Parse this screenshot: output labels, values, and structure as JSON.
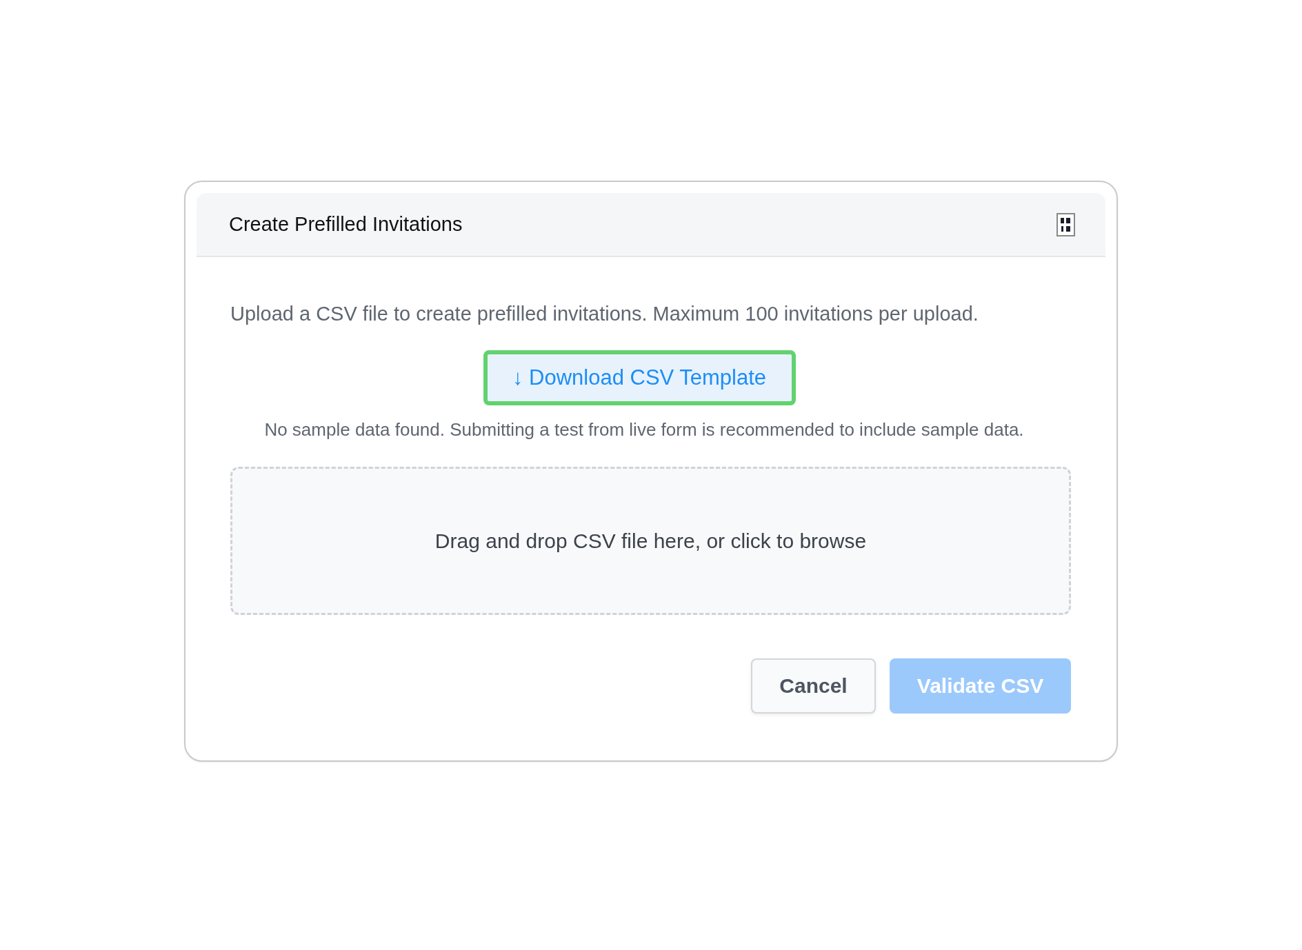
{
  "dialog": {
    "title": "Create Prefilled Invitations"
  },
  "description": "Upload a CSV file to create prefilled invitations. Maximum 100 invitations per upload.",
  "download_button": {
    "label": "↓ Download CSV Template",
    "highlighted": true
  },
  "note": "No sample data found. Submitting a test from live form is recommended to include sample data.",
  "dropzone": {
    "label": "Drag and drop CSV file here, or click to browse"
  },
  "buttons": [
    {
      "label": "Cancel",
      "kind": "secondary",
      "disabled": false
    },
    {
      "label": "Validate CSV",
      "kind": "primary",
      "disabled": true
    }
  ]
}
